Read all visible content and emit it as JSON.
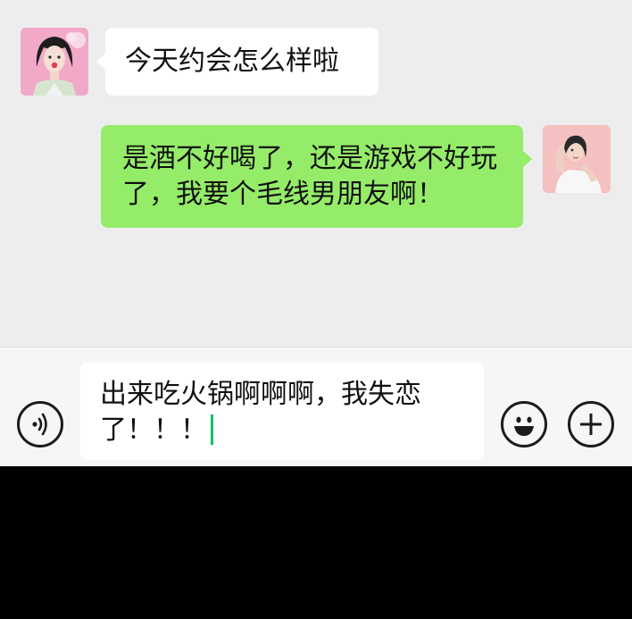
{
  "messages": [
    {
      "side": "left",
      "text": "今天约会怎么样啦"
    },
    {
      "side": "right",
      "text": "是酒不好喝了，还是游戏不好玩了，我要个毛线男朋友啊！"
    }
  ],
  "input": {
    "value": "出来吃火锅啊啊啊，我失恋了！！！"
  },
  "icons": {
    "voice": "voice-icon",
    "emoji": "emoji-icon",
    "plus": "plus-icon"
  },
  "colors": {
    "chat_background": "#ededed",
    "received_bubble": "#ffffff",
    "sent_bubble": "#95ec69",
    "caret": "#07c160"
  }
}
